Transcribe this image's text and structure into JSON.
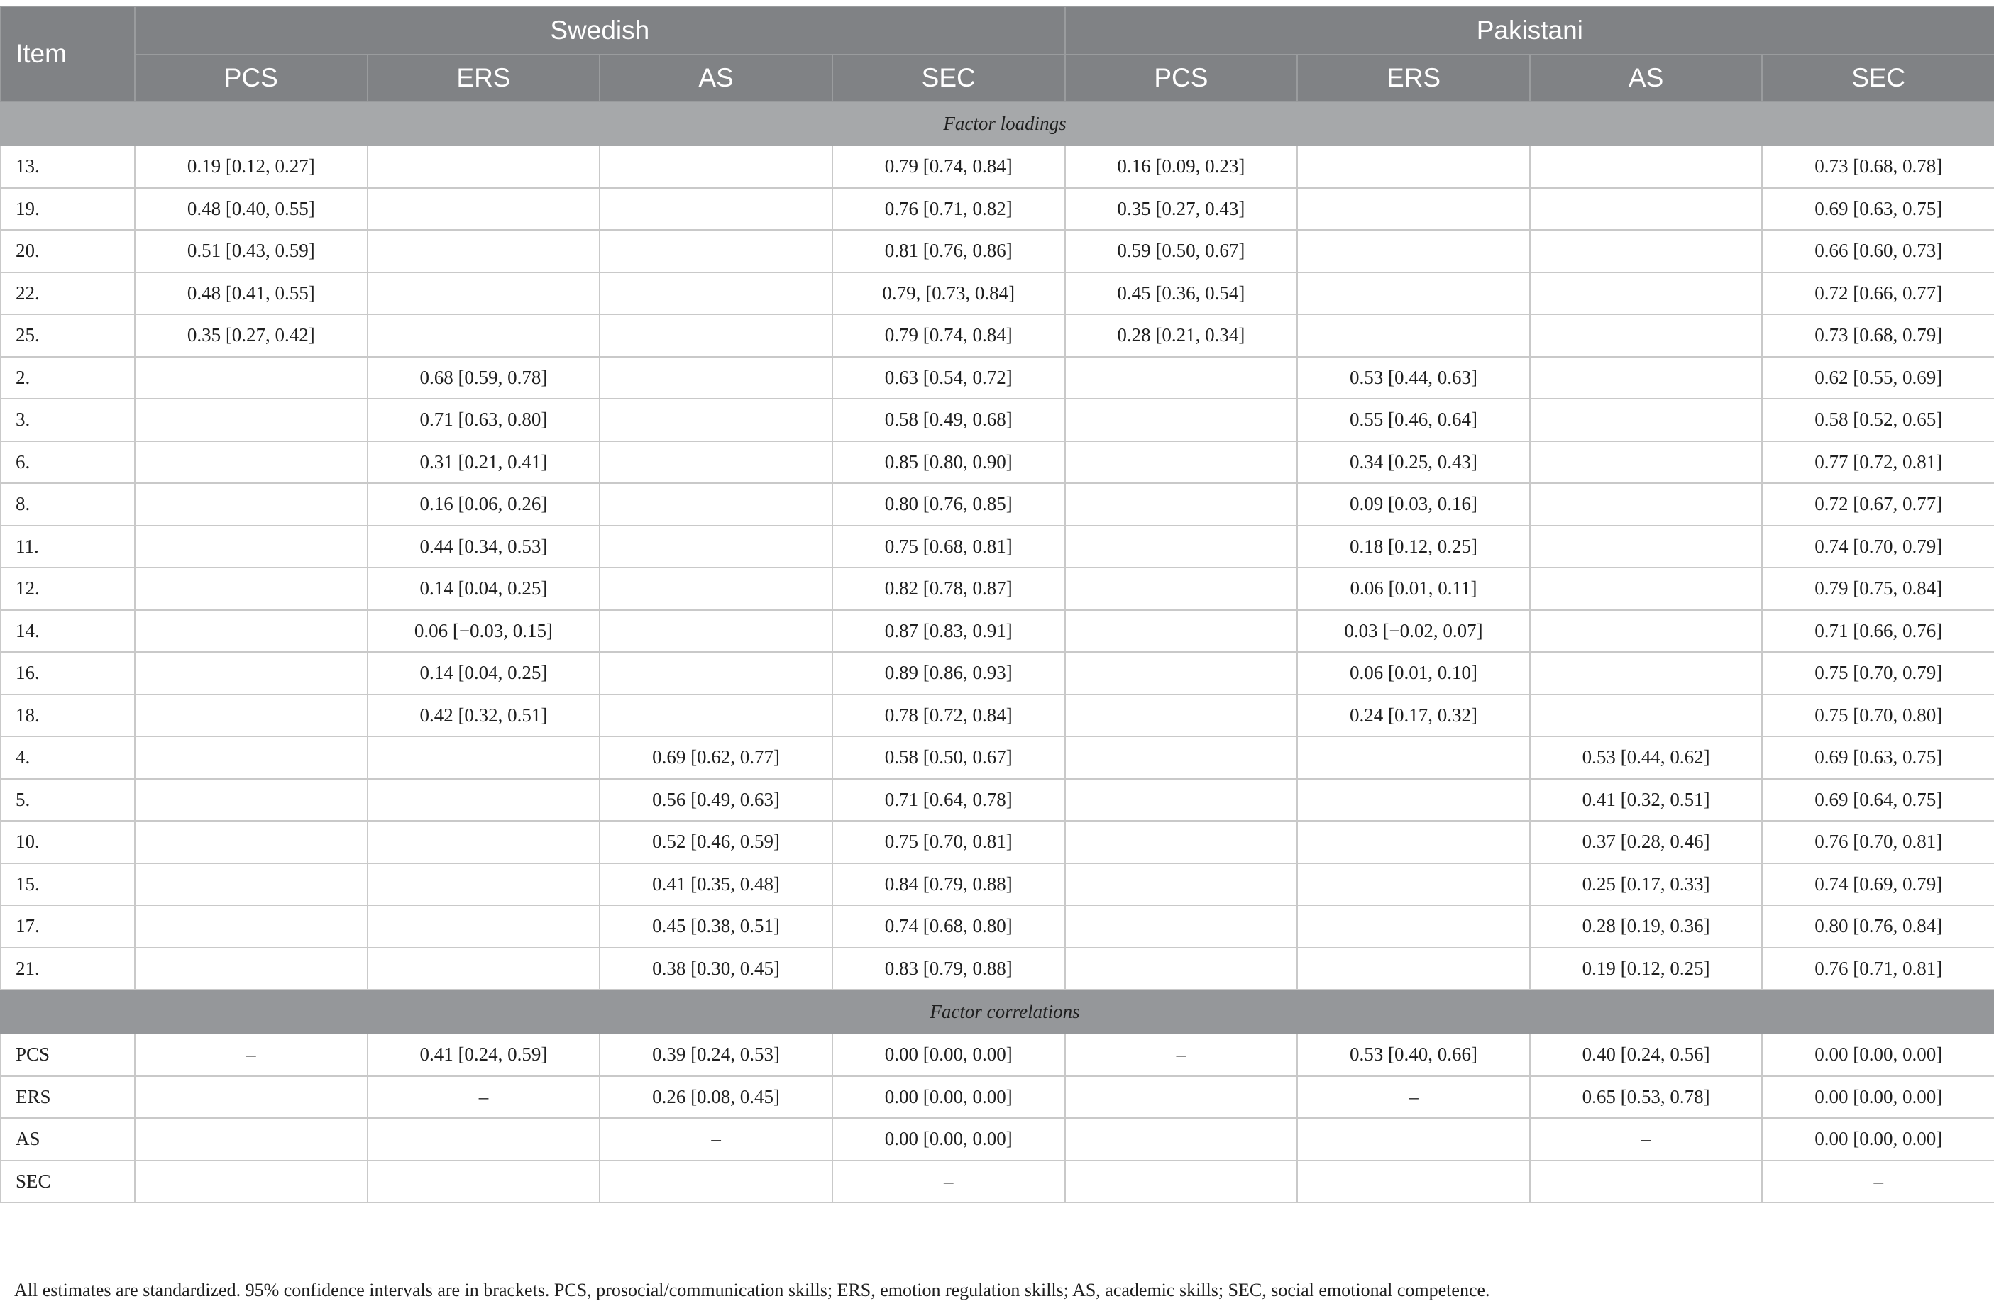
{
  "header": {
    "item_label": "Item",
    "groups": [
      "Swedish",
      "Pakistani"
    ],
    "subcolumns": [
      "PCS",
      "ERS",
      "AS",
      "SEC",
      "PCS",
      "ERS",
      "AS",
      "SEC"
    ]
  },
  "sections": [
    {
      "title": "Factor loadings",
      "rows": [
        {
          "item": "13.",
          "cells": [
            "0.19 [0.12, 0.27]",
            "",
            "",
            "0.79 [0.74, 0.84]",
            "0.16 [0.09, 0.23]",
            "",
            "",
            "0.73 [0.68, 0.78]"
          ]
        },
        {
          "item": "19.",
          "cells": [
            "0.48 [0.40, 0.55]",
            "",
            "",
            "0.76 [0.71, 0.82]",
            "0.35 [0.27, 0.43]",
            "",
            "",
            "0.69 [0.63, 0.75]"
          ]
        },
        {
          "item": "20.",
          "cells": [
            "0.51 [0.43, 0.59]",
            "",
            "",
            "0.81 [0.76, 0.86]",
            "0.59 [0.50, 0.67]",
            "",
            "",
            "0.66 [0.60, 0.73]"
          ]
        },
        {
          "item": "22.",
          "cells": [
            "0.48 [0.41, 0.55]",
            "",
            "",
            "0.79, [0.73, 0.84]",
            "0.45 [0.36, 0.54]",
            "",
            "",
            "0.72 [0.66, 0.77]"
          ]
        },
        {
          "item": "25.",
          "cells": [
            "0.35 [0.27, 0.42]",
            "",
            "",
            "0.79 [0.74, 0.84]",
            "0.28 [0.21, 0.34]",
            "",
            "",
            "0.73 [0.68, 0.79]"
          ]
        },
        {
          "item": "2.",
          "cells": [
            "",
            "0.68 [0.59, 0.78]",
            "",
            "0.63 [0.54, 0.72]",
            "",
            "0.53 [0.44, 0.63]",
            "",
            "0.62 [0.55, 0.69]"
          ]
        },
        {
          "item": "3.",
          "cells": [
            "",
            "0.71 [0.63, 0.80]",
            "",
            "0.58 [0.49, 0.68]",
            "",
            "0.55 [0.46, 0.64]",
            "",
            "0.58 [0.52, 0.65]"
          ]
        },
        {
          "item": "6.",
          "cells": [
            "",
            "0.31 [0.21, 0.41]",
            "",
            "0.85 [0.80, 0.90]",
            "",
            "0.34 [0.25, 0.43]",
            "",
            "0.77 [0.72, 0.81]"
          ]
        },
        {
          "item": "8.",
          "cells": [
            "",
            "0.16 [0.06, 0.26]",
            "",
            "0.80 [0.76, 0.85]",
            "",
            "0.09 [0.03, 0.16]",
            "",
            "0.72 [0.67, 0.77]"
          ]
        },
        {
          "item": "11.",
          "cells": [
            "",
            "0.44 [0.34, 0.53]",
            "",
            "0.75 [0.68, 0.81]",
            "",
            "0.18 [0.12, 0.25]",
            "",
            "0.74 [0.70, 0.79]"
          ]
        },
        {
          "item": "12.",
          "cells": [
            "",
            "0.14 [0.04, 0.25]",
            "",
            "0.82 [0.78, 0.87]",
            "",
            "0.06 [0.01, 0.11]",
            "",
            "0.79 [0.75, 0.84]"
          ]
        },
        {
          "item": "14.",
          "cells": [
            "",
            "0.06 [−0.03, 0.15]",
            "",
            "0.87 [0.83, 0.91]",
            "",
            "0.03 [−0.02, 0.07]",
            "",
            "0.71 [0.66, 0.76]"
          ]
        },
        {
          "item": "16.",
          "cells": [
            "",
            "0.14 [0.04, 0.25]",
            "",
            "0.89 [0.86, 0.93]",
            "",
            "0.06 [0.01, 0.10]",
            "",
            "0.75 [0.70, 0.79]"
          ]
        },
        {
          "item": "18.",
          "cells": [
            "",
            "0.42 [0.32, 0.51]",
            "",
            "0.78 [0.72, 0.84]",
            "",
            "0.24 [0.17, 0.32]",
            "",
            "0.75 [0.70, 0.80]"
          ]
        },
        {
          "item": "4.",
          "cells": [
            "",
            "",
            "0.69 [0.62, 0.77]",
            "0.58 [0.50, 0.67]",
            "",
            "",
            "0.53 [0.44, 0.62]",
            "0.69 [0.63, 0.75]"
          ]
        },
        {
          "item": "5.",
          "cells": [
            "",
            "",
            "0.56 [0.49, 0.63]",
            "0.71 [0.64, 0.78]",
            "",
            "",
            "0.41 [0.32, 0.51]",
            "0.69 [0.64, 0.75]"
          ]
        },
        {
          "item": "10.",
          "cells": [
            "",
            "",
            "0.52 [0.46, 0.59]",
            "0.75 [0.70, 0.81]",
            "",
            "",
            "0.37 [0.28, 0.46]",
            "0.76 [0.70, 0.81]"
          ]
        },
        {
          "item": "15.",
          "cells": [
            "",
            "",
            "0.41 [0.35, 0.48]",
            "0.84 [0.79, 0.88]",
            "",
            "",
            "0.25 [0.17, 0.33]",
            "0.74 [0.69, 0.79]"
          ]
        },
        {
          "item": "17.",
          "cells": [
            "",
            "",
            "0.45 [0.38, 0.51]",
            "0.74 [0.68, 0.80]",
            "",
            "",
            "0.28 [0.19, 0.36]",
            "0.80 [0.76, 0.84]"
          ]
        },
        {
          "item": "21.",
          "cells": [
            "",
            "",
            "0.38 [0.30, 0.45]",
            "0.83 [0.79, 0.88]",
            "",
            "",
            "0.19 [0.12, 0.25]",
            "0.76 [0.71, 0.81]"
          ]
        }
      ]
    },
    {
      "title": "Factor correlations",
      "rows": [
        {
          "item": "PCS",
          "cells": [
            "–",
            "0.41 [0.24, 0.59]",
            "0.39 [0.24, 0.53]",
            "0.00 [0.00, 0.00]",
            "–",
            "0.53 [0.40, 0.66]",
            "0.40 [0.24, 0.56]",
            "0.00 [0.00, 0.00]"
          ]
        },
        {
          "item": "ERS",
          "cells": [
            "",
            "–",
            "0.26 [0.08, 0.45]",
            "0.00 [0.00, 0.00]",
            "",
            "–",
            "0.65 [0.53, 0.78]",
            "0.00 [0.00, 0.00]"
          ]
        },
        {
          "item": "AS",
          "cells": [
            "",
            "",
            "–",
            "0.00 [0.00, 0.00]",
            "",
            "",
            "–",
            "0.00 [0.00, 0.00]"
          ]
        },
        {
          "item": "SEC",
          "cells": [
            "",
            "",
            "",
            "–",
            "",
            "",
            "",
            "–"
          ]
        }
      ]
    }
  ],
  "footnote": "All estimates are standardized. 95% confidence intervals are in brackets. PCS, prosocial/communication skills; ERS, emotion regulation skills; AS, academic skills; SEC, social emotional competence."
}
